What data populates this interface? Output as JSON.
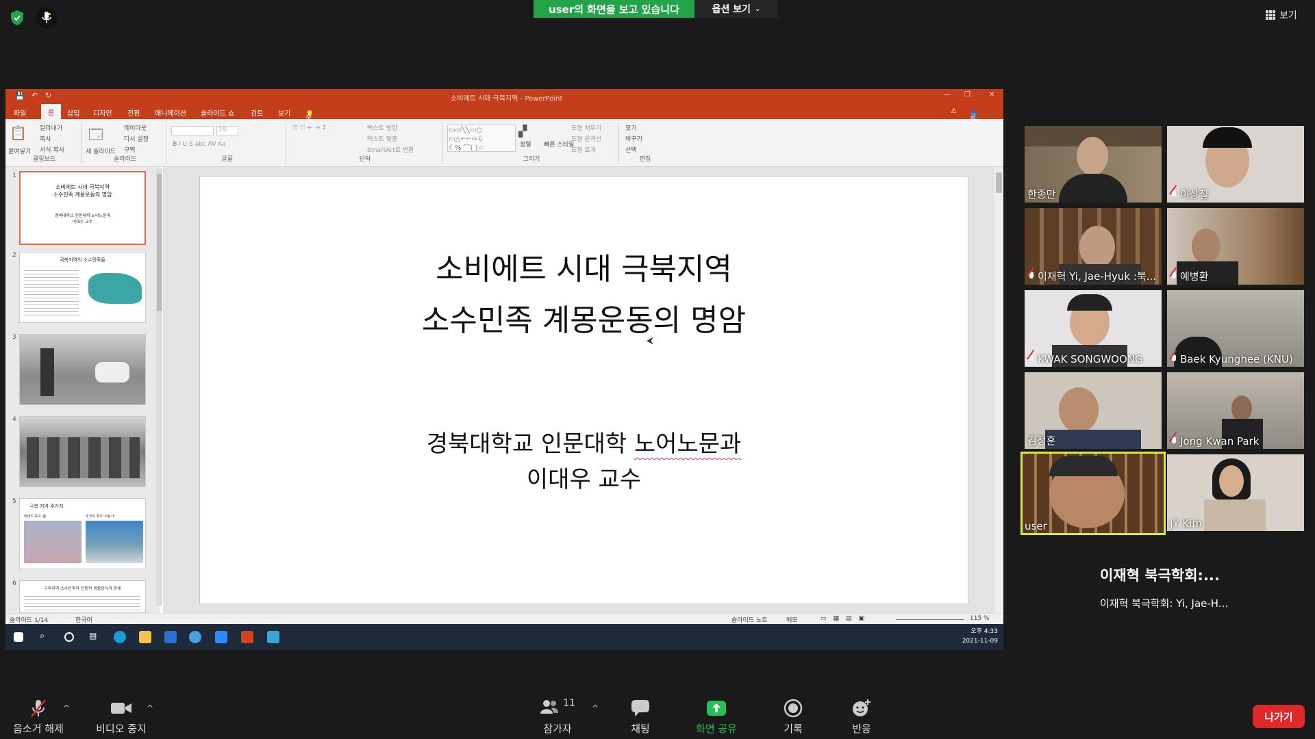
{
  "top": {
    "banner": "user의 화면을 보고 있습니다",
    "view_options": "옵션 보기",
    "view_toggle": "보기"
  },
  "ppt": {
    "window_title": "소비에트 시대 극북지역 - PowerPoint",
    "tabs": [
      "파일",
      "홈",
      "삽입",
      "디자인",
      "전환",
      "애니메이션",
      "슬라이드 쇼",
      "검토",
      "보기"
    ],
    "tell_me": "수행할 작업을 알려 주세요.",
    "share": "공유",
    "ribbon_groups": {
      "clipboard": {
        "label": "클립보드",
        "paste": "붙여넣기",
        "cut": "잘라내기",
        "copy": "복사",
        "format_painter": "서식 복사"
      },
      "slides": {
        "label": "슬라이드",
        "new_slide": "새 슬라이드",
        "layout": "레이아웃",
        "reset": "다시 설정",
        "section": "구역"
      },
      "font": {
        "label": "글꼴",
        "size": "28"
      },
      "paragraph": {
        "label": "단락",
        "text_direction": "텍스트 방향",
        "align_text": "텍스트 맞춤",
        "smartart": "SmartArt로 변환"
      },
      "drawing": {
        "label": "그리기",
        "arrange": "정렬",
        "quick_styles": "빠른 스타일",
        "fill": "도형 채우기",
        "outline": "도형 윤곽선",
        "effects": "도형 효과"
      },
      "editing": {
        "label": "편집",
        "find": "찾기",
        "replace": "바꾸기",
        "select": "선택"
      }
    },
    "thumbnails": [
      {
        "num": "1",
        "line1": "소비에트 시대 극북지역",
        "line2": "소수민족 계몽운동의 명암",
        "line3": "경북대학교 인문대학 노어노문과",
        "line4": "이대우 교수"
      },
      {
        "num": "2",
        "title": "극북지역의 소수민족들"
      },
      {
        "num": "3"
      },
      {
        "num": "4"
      },
      {
        "num": "5",
        "title": "극북 지역 주거지",
        "cap1": "네네츠 족의 '춤'",
        "cap2": "추크치 족의 '야랑가'"
      },
      {
        "num": "6",
        "title": "극북지역 소수민족의 전통적 생활양식과 문제"
      }
    ],
    "slide": {
      "title_line1": "소비에트 시대 극북지역",
      "title_line2": "소수민족 계몽운동의 명암",
      "sub_line1_a": "경북대학교 인문대학 ",
      "sub_line1_b": "노어노문과",
      "sub_line2": "이대우 교수"
    },
    "status": {
      "slide_count": "슬라이드 1/14",
      "language": "한국어",
      "notes": "슬라이드 노트",
      "comments": "메모",
      "zoom": "115 %"
    },
    "clock": {
      "time": "오후 4:33",
      "date": "2021-11-09"
    }
  },
  "participants": [
    {
      "name": "한종만",
      "muted": false
    },
    {
      "name": "이상철",
      "muted": true
    },
    {
      "name": "이재혁 Yi, Jae-Hyuk :북...",
      "muted": true
    },
    {
      "name": "예병환",
      "muted": true
    },
    {
      "name": "KWAK SONGWOONG",
      "muted": true
    },
    {
      "name": "Baek Kyunghee (KNU)",
      "muted": true
    },
    {
      "name": "김정훈",
      "muted": false
    },
    {
      "name": "Jong Kwan Park",
      "muted": true
    },
    {
      "name": "user",
      "muted": false,
      "active": true
    },
    {
      "name": "JY Kim",
      "muted": false
    }
  ],
  "speaker": {
    "name": "이재혁 북극학회:...",
    "sub": "이재혁 북극학회: Yi, Jae-H..."
  },
  "toolbar": {
    "unmute": "음소거 해제",
    "stop_video": "비디오 중지",
    "participants": "참가자",
    "participant_count": "11",
    "chat": "채팅",
    "share_screen": "화면 공유",
    "record": "기록",
    "reactions": "반응",
    "leave": "나가기"
  },
  "colors": {
    "share_green": "#23a34a",
    "ppt_orange": "#c43e1c",
    "leave_red": "#e02828",
    "active_outline": "#d6e84a"
  }
}
